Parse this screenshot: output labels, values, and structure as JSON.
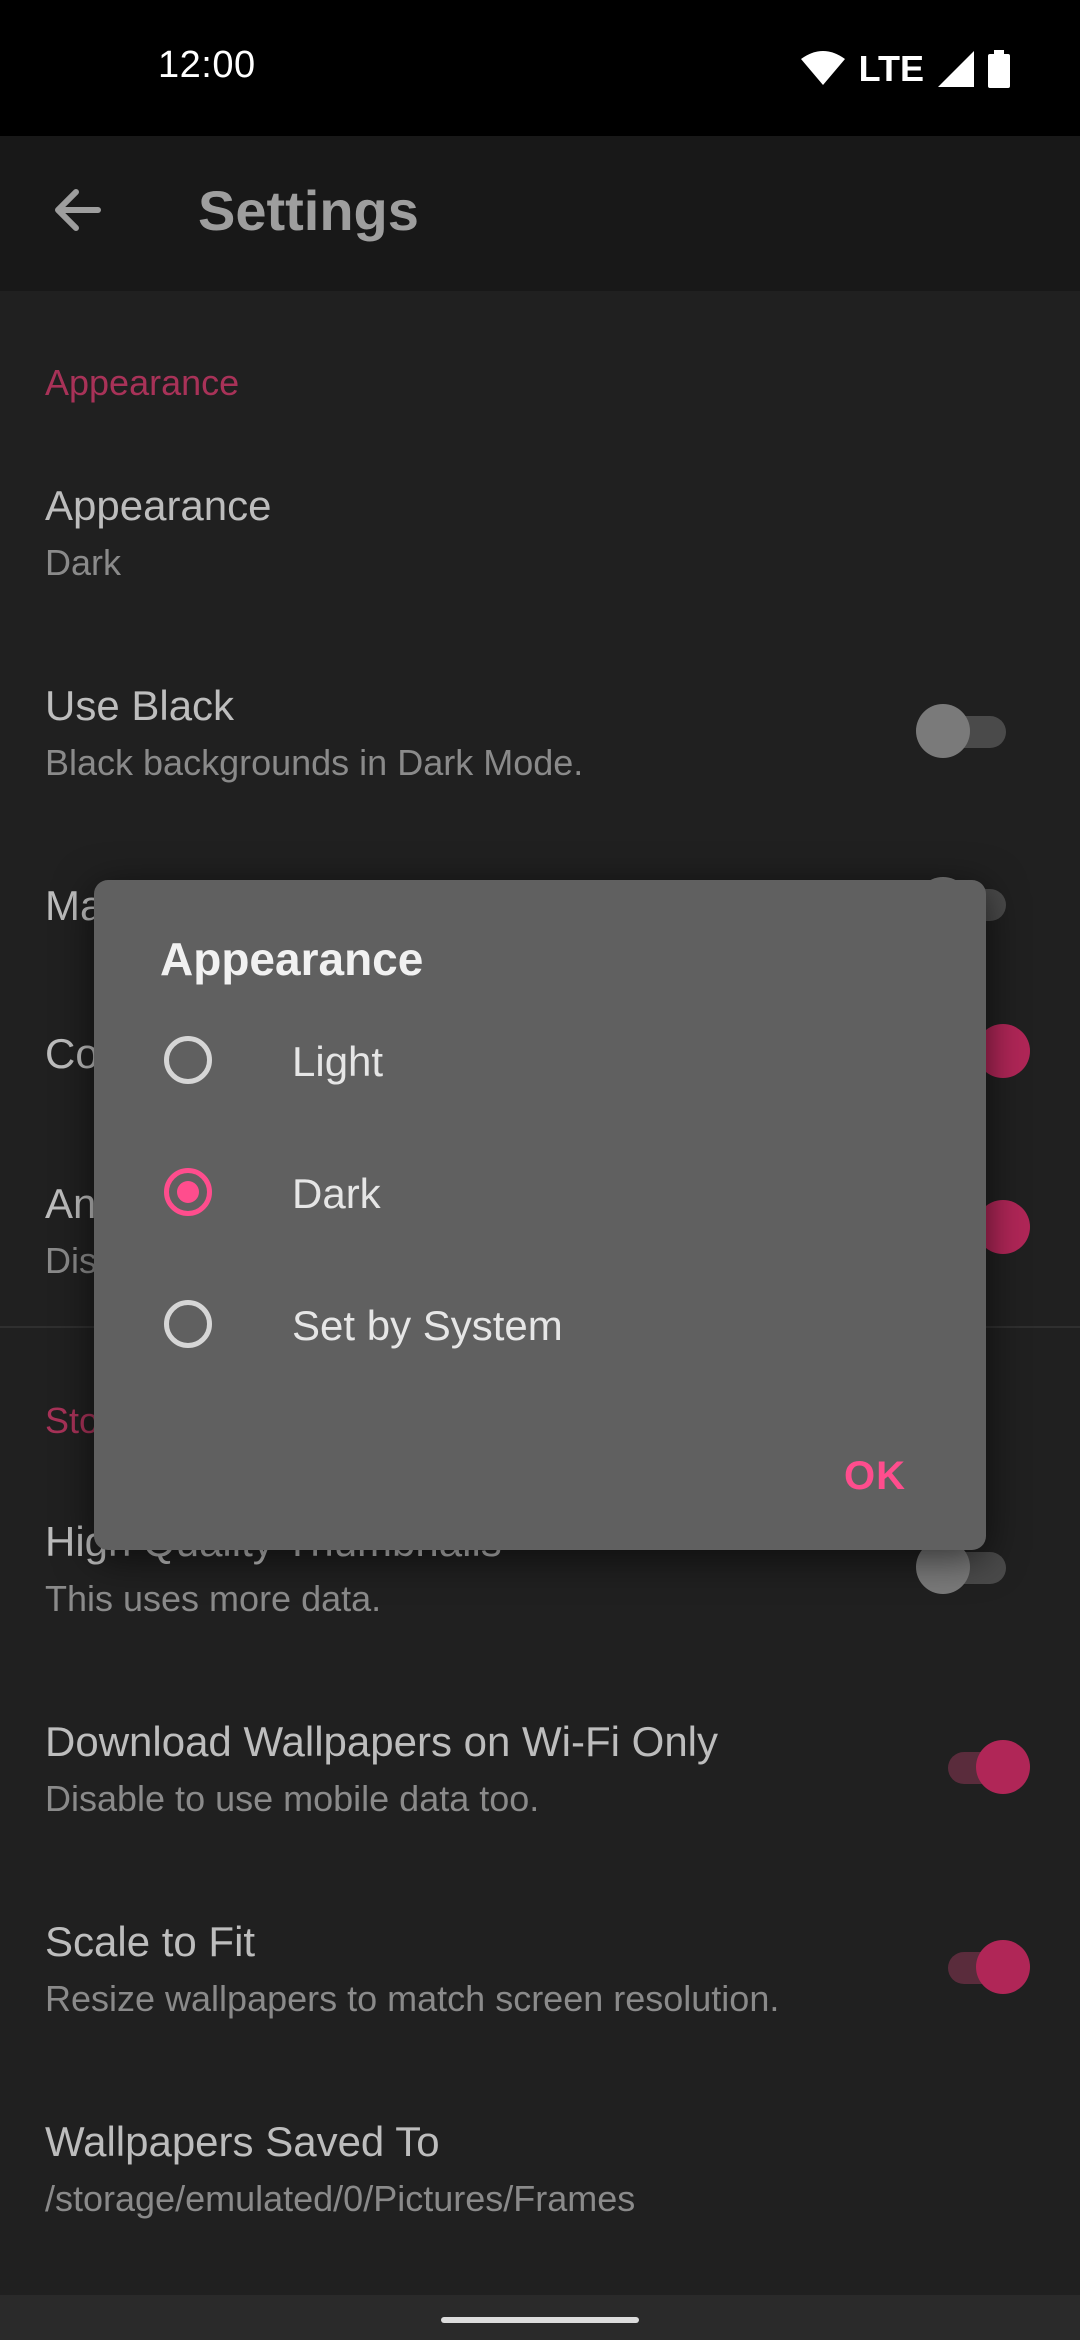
{
  "status_bar": {
    "time": "12:00",
    "network": "LTE"
  },
  "app_bar": {
    "title": "Settings"
  },
  "sections": {
    "appearance_header": "Appearance",
    "storage_header_partial": "Sto"
  },
  "settings": {
    "appearance": {
      "title": "Appearance",
      "value": "Dark"
    },
    "use_black": {
      "title": "Use Black",
      "subtitle": "Black backgrounds in Dark Mode.",
      "enabled": false
    },
    "partial_1": {
      "title": "Ma",
      "enabled": false
    },
    "partial_2": {
      "title": "Co",
      "enabled": true
    },
    "partial_3": {
      "title": "An",
      "subtitle": "Dis",
      "enabled": true
    },
    "high_quality": {
      "title": "High Quality Thumbnails",
      "subtitle": "This uses more data.",
      "enabled": false
    },
    "wifi_only": {
      "title": "Download Wallpapers on Wi-Fi Only",
      "subtitle": "Disable to use mobile data too.",
      "enabled": true
    },
    "scale_to_fit": {
      "title": "Scale to Fit",
      "subtitle": "Resize wallpapers to match screen resolution.",
      "enabled": true
    },
    "saved_to": {
      "title": "Wallpapers Saved To",
      "subtitle": "/storage/emulated/0/Pictures/Frames"
    }
  },
  "dialog": {
    "title": "Appearance",
    "options": [
      "Light",
      "Dark",
      "Set by System"
    ],
    "selected": "Dark",
    "ok_label": "OK"
  },
  "colors": {
    "accent": "#ff4d8d",
    "background": "#202020",
    "dialog": "#606060"
  }
}
